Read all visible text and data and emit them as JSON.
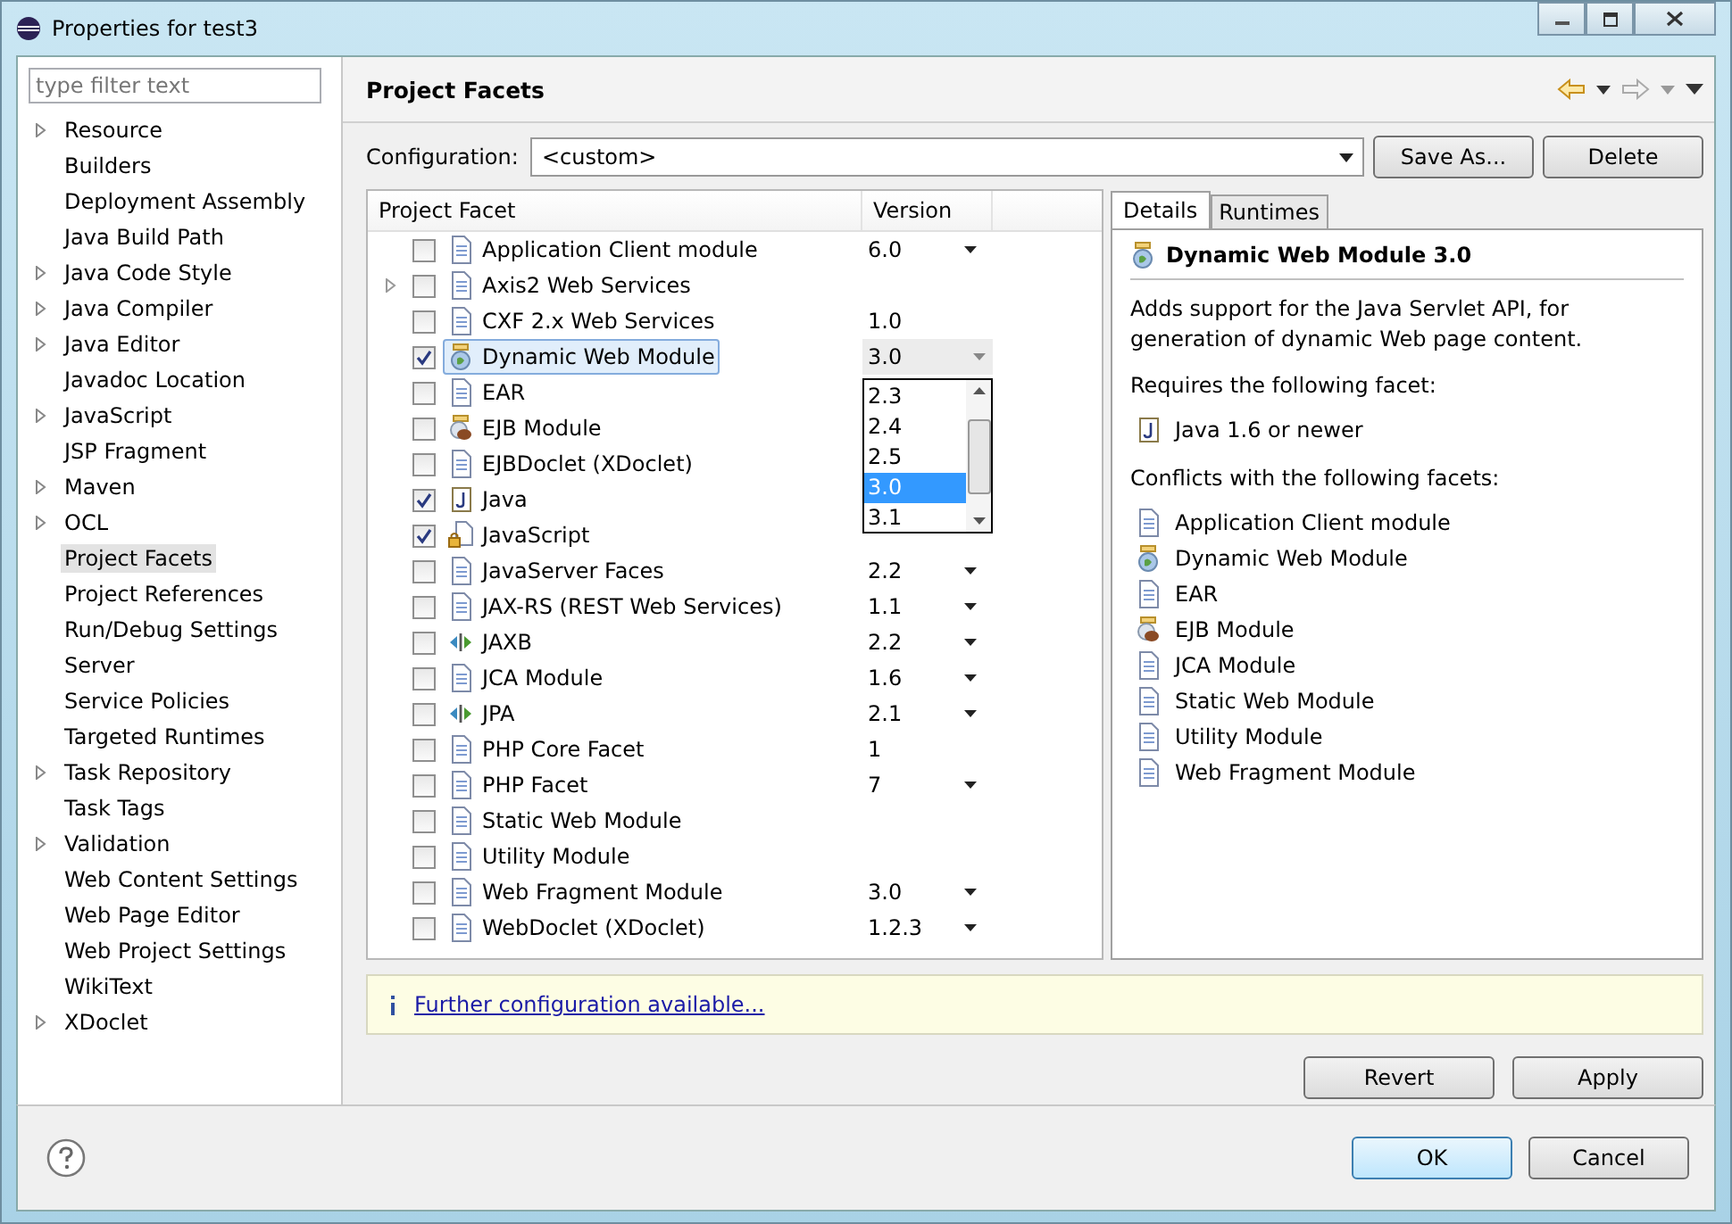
{
  "window": {
    "title": "Properties for test3"
  },
  "filter": {
    "placeholder": "type filter text"
  },
  "sidebar": {
    "items": [
      {
        "label": "Resource",
        "expandable": true,
        "selected": false
      },
      {
        "label": "Builders",
        "expandable": false,
        "selected": false
      },
      {
        "label": "Deployment Assembly",
        "expandable": false,
        "selected": false
      },
      {
        "label": "Java Build Path",
        "expandable": false,
        "selected": false
      },
      {
        "label": "Java Code Style",
        "expandable": true,
        "selected": false
      },
      {
        "label": "Java Compiler",
        "expandable": true,
        "selected": false
      },
      {
        "label": "Java Editor",
        "expandable": true,
        "selected": false
      },
      {
        "label": "Javadoc Location",
        "expandable": false,
        "selected": false
      },
      {
        "label": "JavaScript",
        "expandable": true,
        "selected": false
      },
      {
        "label": "JSP Fragment",
        "expandable": false,
        "selected": false
      },
      {
        "label": "Maven",
        "expandable": true,
        "selected": false
      },
      {
        "label": "OCL",
        "expandable": true,
        "selected": false
      },
      {
        "label": "Project Facets",
        "expandable": false,
        "selected": true
      },
      {
        "label": "Project References",
        "expandable": false,
        "selected": false
      },
      {
        "label": "Run/Debug Settings",
        "expandable": false,
        "selected": false
      },
      {
        "label": "Server",
        "expandable": false,
        "selected": false
      },
      {
        "label": "Service Policies",
        "expandable": false,
        "selected": false
      },
      {
        "label": "Targeted Runtimes",
        "expandable": false,
        "selected": false
      },
      {
        "label": "Task Repository",
        "expandable": true,
        "selected": false
      },
      {
        "label": "Task Tags",
        "expandable": false,
        "selected": false
      },
      {
        "label": "Validation",
        "expandable": true,
        "selected": false
      },
      {
        "label": "Web Content Settings",
        "expandable": false,
        "selected": false
      },
      {
        "label": "Web Page Editor",
        "expandable": false,
        "selected": false
      },
      {
        "label": "Web Project Settings",
        "expandable": false,
        "selected": false
      },
      {
        "label": "WikiText",
        "expandable": false,
        "selected": false
      },
      {
        "label": "XDoclet",
        "expandable": true,
        "selected": false
      }
    ]
  },
  "page": {
    "title": "Project Facets",
    "configuration_label": "Configuration:",
    "configuration_value": "<custom>",
    "buttons": [
      "Save As...",
      "Delete"
    ]
  },
  "facets": {
    "columns": [
      "Project Facet",
      "Version"
    ],
    "rows": [
      {
        "name": "Application Client module",
        "kind": "page",
        "checked": false,
        "expandable": false,
        "selected": false,
        "version": "6.0",
        "dropdown": true
      },
      {
        "name": "Axis2 Web Services",
        "kind": "page",
        "checked": false,
        "expandable": true,
        "selected": false
      },
      {
        "name": "CXF 2.x Web Services",
        "kind": "page",
        "checked": false,
        "expandable": false,
        "selected": false,
        "version": "1.0",
        "dropdown": false
      },
      {
        "name": "Dynamic Web Module",
        "kind": "globe",
        "checked": true,
        "expandable": false,
        "selected": true,
        "version": "3.0",
        "dropdown": true
      },
      {
        "name": "EAR",
        "kind": "page",
        "checked": false,
        "expandable": false,
        "selected": false
      },
      {
        "name": "EJB Module",
        "kind": "bean",
        "checked": false,
        "expandable": false,
        "selected": false
      },
      {
        "name": "EJBDoclet (XDoclet)",
        "kind": "page",
        "checked": false,
        "expandable": false,
        "selected": false
      },
      {
        "name": "Java",
        "kind": "java",
        "checked": true,
        "expandable": false,
        "selected": false
      },
      {
        "name": "JavaScript",
        "kind": "locked",
        "checked": true,
        "expandable": false,
        "selected": false
      },
      {
        "name": "JavaServer Faces",
        "kind": "page",
        "checked": false,
        "expandable": false,
        "selected": false,
        "version": "2.2",
        "dropdown": true
      },
      {
        "name": "JAX-RS (REST Web Services)",
        "kind": "page",
        "checked": false,
        "expandable": false,
        "selected": false,
        "version": "1.1",
        "dropdown": true
      },
      {
        "name": "JAXB",
        "kind": "arrows",
        "checked": false,
        "expandable": false,
        "selected": false,
        "version": "2.2",
        "dropdown": true
      },
      {
        "name": "JCA Module",
        "kind": "page",
        "checked": false,
        "expandable": false,
        "selected": false,
        "version": "1.6",
        "dropdown": true
      },
      {
        "name": "JPA",
        "kind": "arrows",
        "checked": false,
        "expandable": false,
        "selected": false,
        "version": "2.1",
        "dropdown": true
      },
      {
        "name": "PHP Core Facet",
        "kind": "page",
        "checked": false,
        "expandable": false,
        "selected": false,
        "version": "1",
        "dropdown": false
      },
      {
        "name": "PHP Facet",
        "kind": "page",
        "checked": false,
        "expandable": false,
        "selected": false,
        "version": "7",
        "dropdown": true
      },
      {
        "name": "Static Web Module",
        "kind": "page",
        "checked": false,
        "expandable": false,
        "selected": false
      },
      {
        "name": "Utility Module",
        "kind": "page",
        "checked": false,
        "expandable": false,
        "selected": false
      },
      {
        "name": "Web Fragment Module",
        "kind": "page",
        "checked": false,
        "expandable": false,
        "selected": false,
        "version": "3.0",
        "dropdown": true
      },
      {
        "name": "WebDoclet (XDoclet)",
        "kind": "page",
        "checked": false,
        "expandable": false,
        "selected": false,
        "version": "1.2.3",
        "dropdown": true
      }
    ]
  },
  "version_popup": {
    "options": [
      {
        "label": "2.3",
        "selected": false
      },
      {
        "label": "2.4",
        "selected": false
      },
      {
        "label": "2.5",
        "selected": false
      },
      {
        "label": "3.0",
        "selected": true
      },
      {
        "label": "3.1",
        "selected": false
      }
    ]
  },
  "details": {
    "tabs": [
      {
        "label": "Details",
        "selected": true
      },
      {
        "label": "Runtimes",
        "selected": false
      }
    ],
    "title": "Dynamic Web Module 3.0",
    "kind": "globe",
    "description": "Adds support for the Java Servlet API, for generation of dynamic Web page content.",
    "requires_label": "Requires the following facet:",
    "requires": [
      {
        "name": "Java 1.6 or newer",
        "kind": "java"
      }
    ],
    "conflicts_label": "Conflicts with the following facets:",
    "conflicts": [
      {
        "name": "Application Client module",
        "kind": "page"
      },
      {
        "name": "Dynamic Web Module",
        "kind": "globe"
      },
      {
        "name": "EAR",
        "kind": "page"
      },
      {
        "name": "EJB Module",
        "kind": "bean"
      },
      {
        "name": "JCA Module",
        "kind": "page"
      },
      {
        "name": "Static Web Module",
        "kind": "page"
      },
      {
        "name": "Utility Module",
        "kind": "page"
      },
      {
        "name": "Web Fragment Module",
        "kind": "page"
      }
    ]
  },
  "info": {
    "link": "Further configuration available..."
  },
  "page_buttons": [
    "Revert",
    "Apply"
  ],
  "dialog_buttons": [
    {
      "label": "OK",
      "default": true
    },
    {
      "label": "Cancel",
      "default": false
    }
  ]
}
